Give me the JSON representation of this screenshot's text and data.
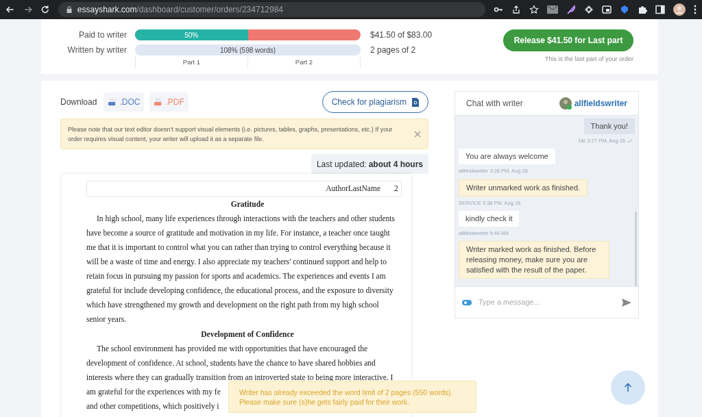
{
  "browser": {
    "url_host": "essayshark.com",
    "url_path": "/dashboard/customer/orders/234712984"
  },
  "progress": {
    "paid": {
      "label": "Paid to writer",
      "level": 0.5,
      "bar_text": "50%",
      "amount": "$41.50 of $83.00"
    },
    "written": {
      "label": "Written by writer",
      "level": 1,
      "bar_text": "108% (598 words)",
      "amount": "2 pages of 2"
    },
    "parts": [
      "Part 1",
      "Part 2"
    ]
  },
  "release": {
    "button": "Release $41.50 for Last part",
    "note": "This is the last part of your order"
  },
  "download": {
    "label": "Download",
    "files": [
      {
        "kind": "doc",
        "label": ".DOC"
      },
      {
        "kind": "pdf",
        "label": ".PDF"
      }
    ]
  },
  "plagiarism_button": "Check for plagiarism",
  "notice": "Please note that our text editor doesn’t support visual elements (i.e. pictures, tables, graphs, presentations, etc.) If your order requires visual content, your writer will upload it as a separate file.",
  "last_updated": {
    "label": "Last updated:",
    "value": "about 4 hours"
  },
  "document": {
    "header": {
      "author": "AuthorLastName",
      "page": "2"
    },
    "blocks": [
      {
        "kind": "heading",
        "text": "Gratitude"
      },
      {
        "kind": "paragraph",
        "lines": [
          "In high school, many life experiences through interactions with the teachers and other students",
          "have become a source of gratitude and motivation in my life. For instance, a teacher once taught",
          "me that it is important to control what you can rather than trying to control everything because it",
          "will be a waste of time and energy. I also appreciate my teachers' continued support and help to",
          "retain focus in pursuing my passion for sports and academics. The experiences and events I am",
          "grateful for include developing confidence, the educational process, and the exposure to diversity",
          "which have strengthened my growth and development on the right path from my high school",
          "senior years."
        ]
      },
      {
        "kind": "heading",
        "text": "Development of Confidence"
      },
      {
        "kind": "paragraph",
        "lines": [
          "The school environment has provided me with opportunities that have encouraged the",
          "development of confidence. At school, students have the chance to have shared hobbies and",
          "interests where they can gradually transition from an introverted state to being more interactive. I",
          "am grateful for the experiences with my fe",
          "and other competitions, which positively i"
        ]
      }
    ]
  },
  "chat": {
    "title": "Chat with writer",
    "writer": "allfieldswriter",
    "messages": [
      {
        "kind": "me",
        "text": "Thank you!",
        "meta": "Me 3:27 PM, Aug 26"
      },
      {
        "kind": "writer",
        "text": "You are always welcome",
        "meta": "allfieldswriter 3:28 PM, Aug 26"
      },
      {
        "kind": "service",
        "text": "Writer unmarked work as finished.",
        "meta": "SERVICE 3:38 PM, Aug 26"
      },
      {
        "kind": "writer",
        "text": "kindly check it",
        "meta": "allfieldswriter 9:49 AM"
      },
      {
        "kind": "service",
        "text": "Writer marked work as finished. Before releasing money, make sure you are satisfied with the result of the paper."
      }
    ],
    "placeholder": "Type a message..."
  },
  "toast": [
    "Writer has already exceeded the word limit of 2 pages (550 words).",
    "Please make sure (s)he gets fairly paid for their work."
  ]
}
